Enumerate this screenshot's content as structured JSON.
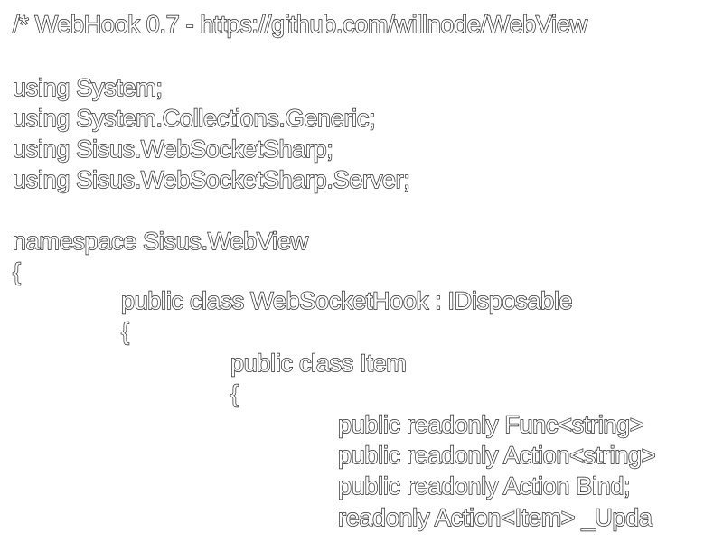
{
  "editor": {
    "lines": [
      "/* WebHook 0.7 - https://github.com/willnode/WebView",
      "using System;",
      "using System.Collections.Generic;",
      "using Sisus.WebSocketSharp;",
      "using Sisus.WebSocketSharp.Server;",
      "namespace Sisus.WebView",
      "{",
      "public class WebSocketHook : IDisposable",
      "{",
      "public class Item",
      "{",
      "public readonly Func<string>",
      "public readonly Action<string>",
      "public readonly Action Bind;",
      "readonly Action<Item> _Upda"
    ]
  }
}
